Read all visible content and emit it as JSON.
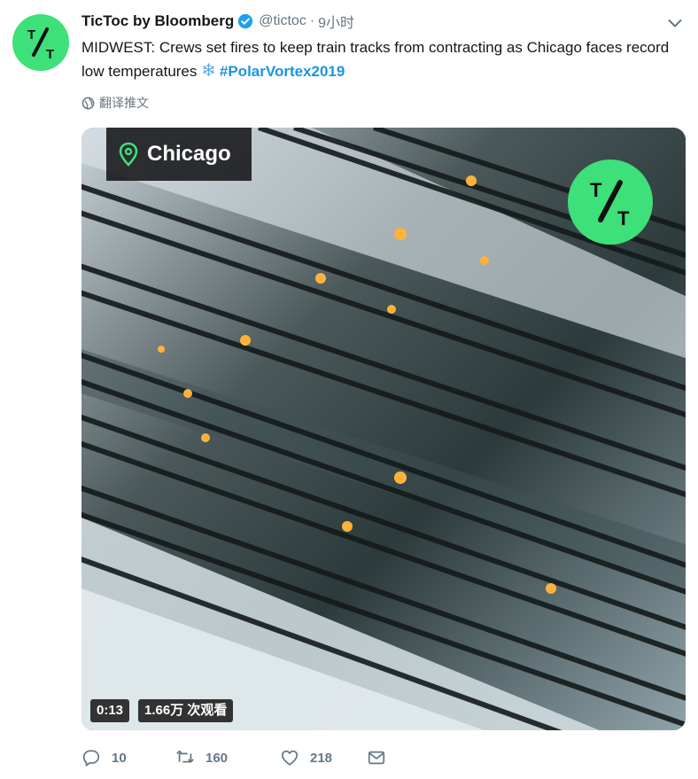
{
  "author": {
    "name": "TicToc by Bloomberg",
    "handle": "@tictoc",
    "separator": "·",
    "time": "9小时",
    "verified": true,
    "avatar_logo_text": "T/T",
    "avatar_color": "#3ee079"
  },
  "tweet": {
    "text": "MIDWEST: Crews set fires to keep train tracks from contracting as Chicago faces record low temperatures",
    "emoji_icon": "snowflake-icon",
    "hashtag": "#PolarVortex2019",
    "hashtag_color": "#1b95e0",
    "translate_label": "翻译推文"
  },
  "media": {
    "location_label": "Chicago",
    "location_icon": "map-pin-icon",
    "location_pin_color": "#3ee079",
    "brand_logo_text": "T/T",
    "duration": "0:13",
    "view_count": "1.66万 次观看"
  },
  "actions": {
    "reply_count": "10",
    "retweet_count": "160",
    "like_count": "218",
    "reply_icon": "reply-icon",
    "retweet_icon": "retweet-icon",
    "like_icon": "heart-icon",
    "message_icon": "envelope-icon",
    "icon_color": "#657786"
  }
}
